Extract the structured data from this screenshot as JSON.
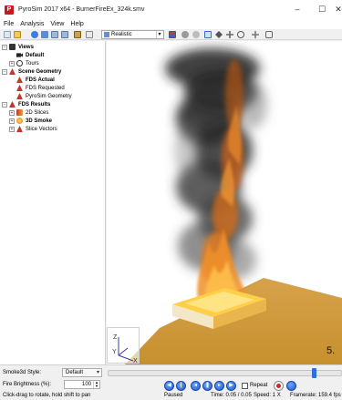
{
  "window": {
    "title": "PyroSim 2017 x64 - BurnerFireEx_324k.smv",
    "app_icon_letter": "P",
    "minimize_glyph": "–",
    "maximize_glyph": "☐",
    "close_glyph": "✕"
  },
  "menu": [
    "File",
    "Analysis",
    "View",
    "Help"
  ],
  "toolbar": {
    "render_mode": "Realistic",
    "icons": [
      "new-file-icon",
      "open-file-icon",
      "smokeview-icon",
      "tree-view-icon",
      "copy-icon",
      "paste-icon",
      "scene-icon",
      "render-mode-icon",
      "colorbar-icon",
      "smoke-icon",
      "particles-icon",
      "select-icon",
      "orbit-icon",
      "pan-icon",
      "zoom-icon",
      "fit-icon",
      "reset-icon"
    ]
  },
  "tree": [
    {
      "label": "Views",
      "level": 0,
      "bold": true,
      "expander": "−",
      "icon": "views-icon",
      "color": "#222222"
    },
    {
      "label": "Default",
      "level": 1,
      "bold": true,
      "expander": "",
      "icon": "camera-icon",
      "color": "#222222"
    },
    {
      "label": "Tours",
      "level": 1,
      "bold": false,
      "expander": "+",
      "icon": "tour-icon",
      "color": "#444444"
    },
    {
      "label": "Scene Geometry",
      "level": 0,
      "bold": true,
      "expander": "−",
      "icon": "geometry-icon",
      "color": "#c0392b"
    },
    {
      "label": "FDS Actual",
      "level": 1,
      "bold": true,
      "expander": "",
      "icon": "fds-icon",
      "color": "#c0392b"
    },
    {
      "label": "FDS Requested",
      "level": 1,
      "bold": false,
      "expander": "",
      "icon": "fds-icon",
      "color": "#c0392b"
    },
    {
      "label": "PyroSim Geometry",
      "level": 1,
      "bold": false,
      "expander": "",
      "icon": "pyrosim-icon",
      "color": "#c0392b"
    },
    {
      "label": "FDS Results",
      "level": 0,
      "bold": true,
      "expander": "−",
      "icon": "results-icon",
      "color": "#c0392b"
    },
    {
      "label": "2D Slices",
      "level": 1,
      "bold": false,
      "expander": "+",
      "icon": "slice-icon",
      "color": "#c0392b"
    },
    {
      "label": "3D Smoke",
      "level": 1,
      "bold": true,
      "expander": "+",
      "icon": "smoke3d-icon",
      "color": "#e39b22"
    },
    {
      "label": "Slice Vectors",
      "level": 1,
      "bold": false,
      "expander": "+",
      "icon": "vector-icon",
      "color": "#c0392b"
    }
  ],
  "viewport": {
    "frame_number": "5.",
    "axes": {
      "z": "Z",
      "y": "Y",
      "x": "X"
    }
  },
  "controls": {
    "smoke_style_label": "Smoke3d Style:",
    "smoke_style_value": "Default",
    "fire_brightness_label": "Fire Brightness (%):",
    "fire_brightness_value": "100",
    "timeline_position": 0.97,
    "repeat_label": "Repeat",
    "repeat_checked": false,
    "playback_buttons": [
      "skip-to-start-icon",
      "step-back-icon",
      "play-back-icon",
      "pause-icon",
      "play-icon",
      "step-forward-icon"
    ]
  },
  "status": {
    "hint": "Click-drag to rotate, hold shift to pan",
    "state": "Paused",
    "time": "Time: 0.05 / 0.05",
    "speed": "Speed: 1 X",
    "framerate": "Framerate: 159.4 fps"
  }
}
